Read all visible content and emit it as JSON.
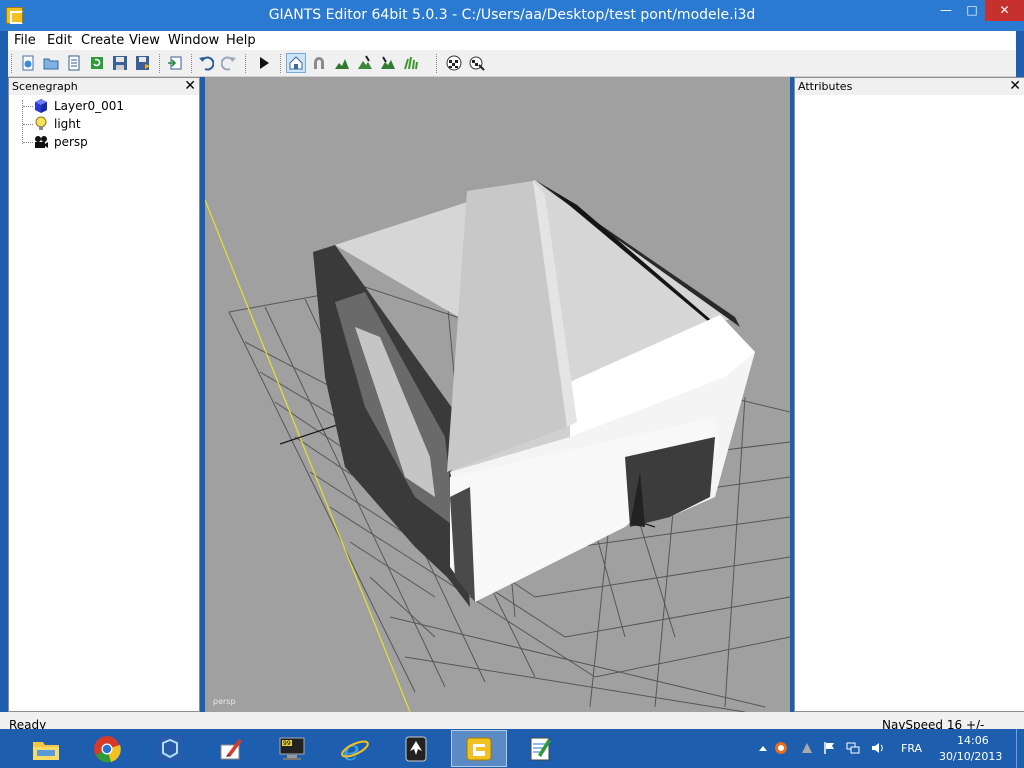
{
  "window": {
    "title": "GIANTS Editor 64bit 5.0.3 - C:/Users/aa/Desktop/test pont/modele.i3d",
    "minimize_glyph": "—",
    "maximize_glyph": "□",
    "close_glyph": "✕"
  },
  "menu": {
    "items": [
      "File",
      "Edit",
      "Create",
      "View",
      "Window",
      "Help"
    ]
  },
  "toolbar": {
    "buttons": [
      {
        "icon": "new-scene-icon"
      },
      {
        "icon": "open-icon"
      },
      {
        "icon": "open-list-icon"
      },
      {
        "icon": "reload-icon"
      },
      {
        "icon": "save-icon"
      },
      {
        "icon": "save-as-icon"
      },
      {
        "icon": "import-icon"
      },
      {
        "icon": "undo-icon"
      },
      {
        "icon": "redo-icon"
      },
      {
        "icon": "play-icon"
      },
      {
        "icon": "select-mode-icon"
      },
      {
        "icon": "magnet-icon"
      },
      {
        "icon": "terrain-sculpt-icon"
      },
      {
        "icon": "terrain-paint-icon"
      },
      {
        "icon": "terrain-smooth-icon"
      },
      {
        "icon": "foliage-paint-icon"
      },
      {
        "icon": "checker-icon"
      },
      {
        "icon": "checker-settings-icon"
      }
    ]
  },
  "scenegraph": {
    "header": "Scenegraph",
    "close": "✕",
    "nodes": [
      {
        "label": "Layer0_001",
        "icon": "cube-icon"
      },
      {
        "label": "light",
        "icon": "bulb-icon"
      },
      {
        "label": "persp",
        "icon": "camera-icon"
      }
    ]
  },
  "attributes": {
    "header": "Attributes",
    "close": "✕"
  },
  "viewport": {
    "camera_label": "persp"
  },
  "status": {
    "left": "Ready",
    "right": "NavSpeed 16 +/-"
  },
  "taskbar": {
    "apps": [
      {
        "icon": "file-explorer-icon"
      },
      {
        "icon": "chrome-icon"
      },
      {
        "icon": "sketchup-icon"
      },
      {
        "icon": "paint-brush-icon"
      },
      {
        "icon": "monitor-99-icon"
      },
      {
        "icon": "internet-explorer-icon"
      },
      {
        "icon": "inkscape-icon"
      },
      {
        "icon": "giants-editor-icon",
        "active": true
      },
      {
        "icon": "notepad-icon"
      }
    ],
    "tray": {
      "lang": "FRA",
      "time": "14:06",
      "date": "30/10/2013"
    }
  }
}
